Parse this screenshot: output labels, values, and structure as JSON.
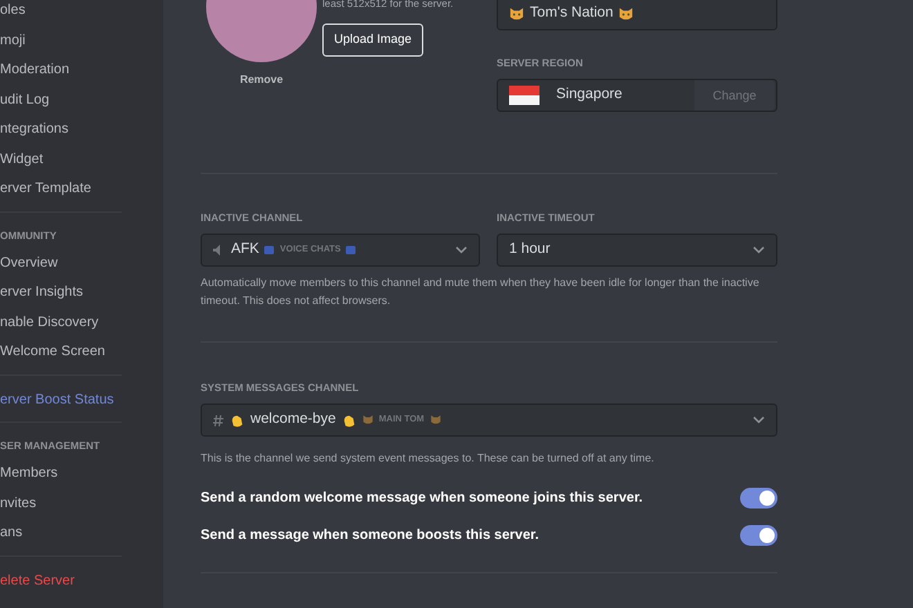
{
  "sidebar": {
    "sections": [
      {
        "items": [
          {
            "label": "oles",
            "kind": "normal"
          },
          {
            "label": "moji",
            "kind": "normal"
          },
          {
            "label": "Moderation",
            "kind": "normal"
          },
          {
            "label": "udit Log",
            "kind": "normal"
          },
          {
            "label": "ntegrations",
            "kind": "normal"
          },
          {
            "label": "Widget",
            "kind": "normal"
          },
          {
            "label": "erver Template",
            "kind": "normal"
          }
        ]
      },
      {
        "heading": "OMMUNITY",
        "items": [
          {
            "label": "Overview",
            "kind": "normal"
          },
          {
            "label": "erver Insights",
            "kind": "normal"
          },
          {
            "label": "nable Discovery",
            "kind": "normal"
          },
          {
            "label": "Welcome Screen",
            "kind": "normal"
          }
        ]
      },
      {
        "items": [
          {
            "label": "erver Boost Status",
            "kind": "boost"
          }
        ]
      },
      {
        "heading": "SER MANAGEMENT",
        "items": [
          {
            "label": "Members",
            "kind": "normal"
          },
          {
            "label": "nvites",
            "kind": "normal"
          },
          {
            "label": "ans",
            "kind": "normal"
          }
        ]
      },
      {
        "items": [
          {
            "label": "elete Server",
            "kind": "danger"
          }
        ]
      }
    ]
  },
  "overview": {
    "avatar_action": "Remove",
    "hint": "least 512x512 for the server.",
    "upload_button": "Upload Image",
    "server_name": "Tom's Nation",
    "server_region": {
      "label": "SERVER REGION",
      "value": "Singapore",
      "button": "Change"
    }
  },
  "inactive": {
    "channel": {
      "label": "INACTIVE CHANNEL",
      "value": "AFK",
      "category": "VOICE CHATS"
    },
    "timeout": {
      "label": "INACTIVE TIMEOUT",
      "value": "1 hour"
    },
    "help": "Automatically move members to this channel and mute them when they have been idle for longer than the inactive timeout. This does not affect browsers."
  },
  "system_messages": {
    "label": "SYSTEM MESSAGES CHANNEL",
    "channel": "welcome-bye",
    "category": "MAIN TOM",
    "help": "This is the channel we send system event messages to. These can be turned off at any time.",
    "toggles": [
      {
        "label": "Send a random welcome message when someone joins this server.",
        "on": true
      },
      {
        "label": "Send a message when someone boosts this server.",
        "on": true
      }
    ]
  }
}
